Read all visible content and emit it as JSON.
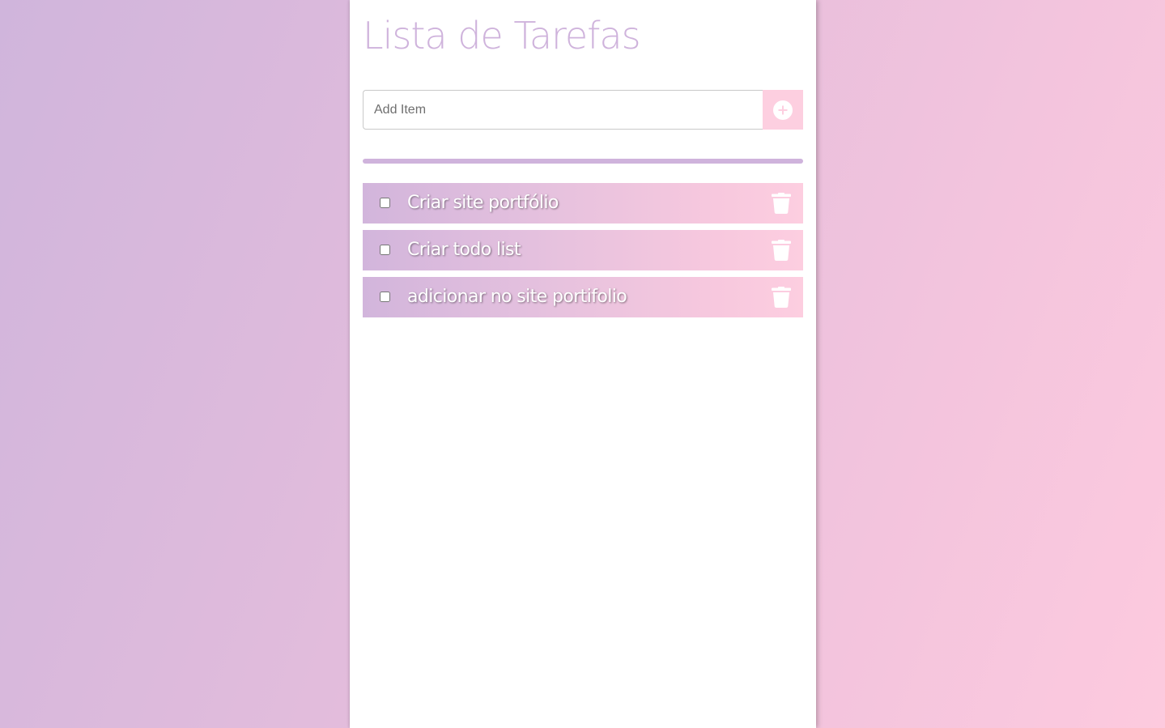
{
  "app": {
    "title": "Lista de Tarefas"
  },
  "add_form": {
    "placeholder": "Add Item",
    "value": "",
    "button_icon": "plus-circle-icon"
  },
  "tasks": [
    {
      "label": "Criar site portfólio",
      "checked": false
    },
    {
      "label": "Criar todo list",
      "checked": false
    },
    {
      "label": "adicionar no site portifolio",
      "checked": false
    }
  ],
  "colors": {
    "accent": "#cfb3dc",
    "button_bg": "#fdcfe0",
    "gradient_start": "#d0b5dc",
    "gradient_end": "#fdcade"
  },
  "icons": {
    "delete": "trash-icon"
  }
}
